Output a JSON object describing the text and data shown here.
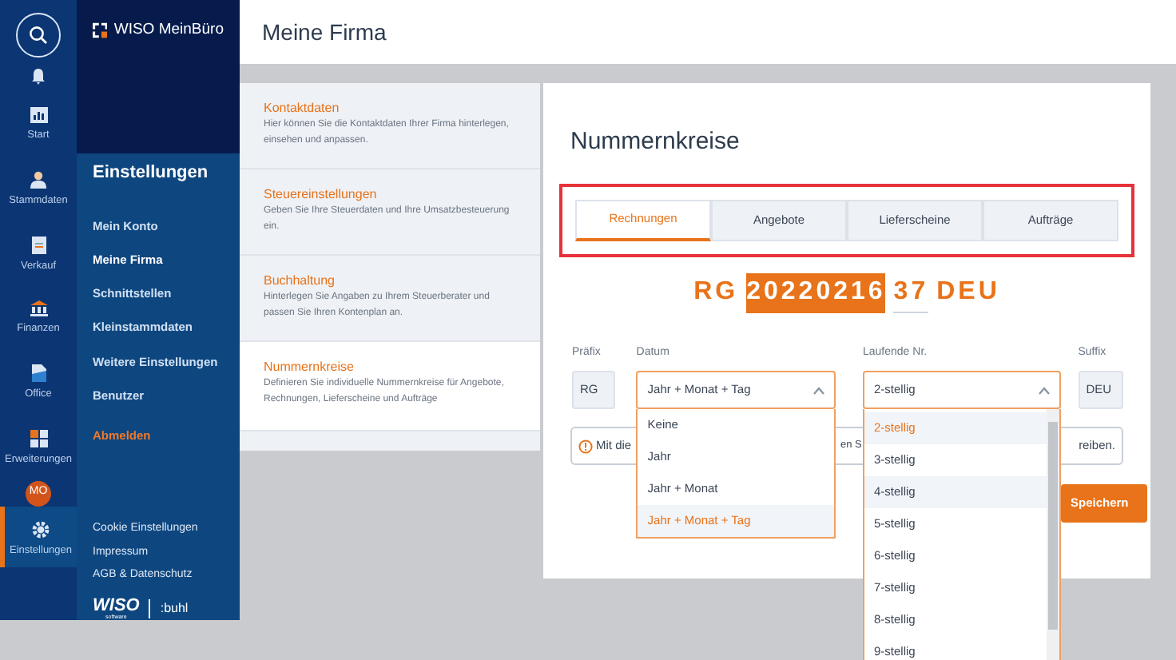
{
  "rail": {
    "items": [
      {
        "kind": "search",
        "selected": false
      },
      {
        "kind": "bell",
        "selected": false
      },
      {
        "kind": "chart",
        "label": "Start",
        "selected": false
      },
      {
        "kind": "person",
        "label": "Stammdaten",
        "selected": false
      },
      {
        "kind": "document",
        "label": "Verkauf",
        "selected": false
      },
      {
        "kind": "bank",
        "label": "Finanzen",
        "selected": false
      },
      {
        "kind": "file",
        "label": "Office",
        "selected": false
      },
      {
        "kind": "grid",
        "label": "Erweiterungen",
        "selected": false
      },
      {
        "kind": "avatar",
        "label": "MO",
        "selected": false
      },
      {
        "kind": "gear",
        "label": "Einstellungen",
        "selected": true
      }
    ]
  },
  "nav": {
    "logo": "WISO MeinBüro",
    "heading": "Einstellungen",
    "items": [
      {
        "label": "Mein Konto",
        "selected": false,
        "kind": "link"
      },
      {
        "label": "Meine Firma",
        "selected": true,
        "kind": "link"
      },
      {
        "label": "Schnittstellen",
        "selected": false,
        "kind": "link"
      },
      {
        "label": "Kleinstammdaten",
        "selected": false,
        "kind": "link"
      },
      {
        "label": "Weitere Einstellungen",
        "selected": false,
        "kind": "link"
      },
      {
        "label": "Benutzer",
        "selected": false,
        "kind": "link"
      },
      {
        "label": "Abmelden",
        "selected": false,
        "kind": "logout"
      }
    ],
    "footer_links": [
      "Cookie Einstellungen",
      "Impressum",
      "AGB & Datenschutz"
    ],
    "brand": {
      "name": "WISO",
      "tagline": "software",
      "partner": ":buhl"
    }
  },
  "page_title": "Meine Firma",
  "sections": [
    {
      "title": "Kontaktdaten",
      "description": "Hier können Sie die Kontaktdaten Ihrer Firma hinterlegen, einsehen und anpassen.",
      "selected": false
    },
    {
      "title": "Steuereinstellungen",
      "description": "Geben Sie Ihre Steuerdaten und Ihre Umsatzbesteuerung ein.",
      "selected": false
    },
    {
      "title": "Buchhaltung",
      "description": "Hinterlegen Sie Angaben zu Ihrem Steuerberater und passen Sie Ihren Kontenplan an.",
      "selected": false
    },
    {
      "title": "Nummernkreise",
      "description": "Definieren Sie individuelle Nummernkreise für Angebote, Rechnungen, Lieferscheine und Aufträge",
      "selected": true
    }
  ],
  "card": {
    "title": "Nummernkreise",
    "tabs": [
      {
        "label": "Rechnungen",
        "selected": true
      },
      {
        "label": "Angebote",
        "selected": false
      },
      {
        "label": "Lieferscheine",
        "selected": false
      },
      {
        "label": "Aufträge",
        "selected": false
      }
    ],
    "preview": {
      "prefix": "RG",
      "date": "20220216",
      "date_highlighted": true,
      "counter": "37",
      "suffix": "DEU"
    },
    "prefix_field": {
      "label": "Präfix",
      "value": "RG"
    },
    "date_field": {
      "label": "Datum",
      "value": "Jahr + Monat + Tag",
      "expanded": true,
      "options": [
        {
          "label": "Keine",
          "selected": false,
          "hovered": false
        },
        {
          "label": "Jahr",
          "selected": false,
          "hovered": false
        },
        {
          "label": "Jahr + Monat",
          "selected": false,
          "hovered": false
        },
        {
          "label": "Jahr + Monat + Tag",
          "selected": true,
          "hovered": false
        }
      ]
    },
    "counter_field": {
      "label": "Laufende Nr.",
      "value": "2-stellig",
      "expanded": true,
      "options": [
        {
          "label": "2-stellig",
          "selected": true,
          "hovered": false
        },
        {
          "label": "3-stellig",
          "selected": false,
          "hovered": false
        },
        {
          "label": "4-stellig",
          "selected": false,
          "hovered": true
        },
        {
          "label": "5-stellig",
          "selected": false,
          "hovered": false
        },
        {
          "label": "6-stellig",
          "selected": false,
          "hovered": false
        },
        {
          "label": "7-stellig",
          "selected": false,
          "hovered": false
        },
        {
          "label": "8-stellig",
          "selected": false,
          "hovered": false
        },
        {
          "label": "9-stellig",
          "selected": false,
          "hovered": false
        }
      ]
    },
    "suffix_field": {
      "label": "Suffix",
      "value": "DEU"
    },
    "notice_fragments": [
      "Mit die",
      "en S",
      "reiben."
    ],
    "save_button": "Speichern"
  }
}
